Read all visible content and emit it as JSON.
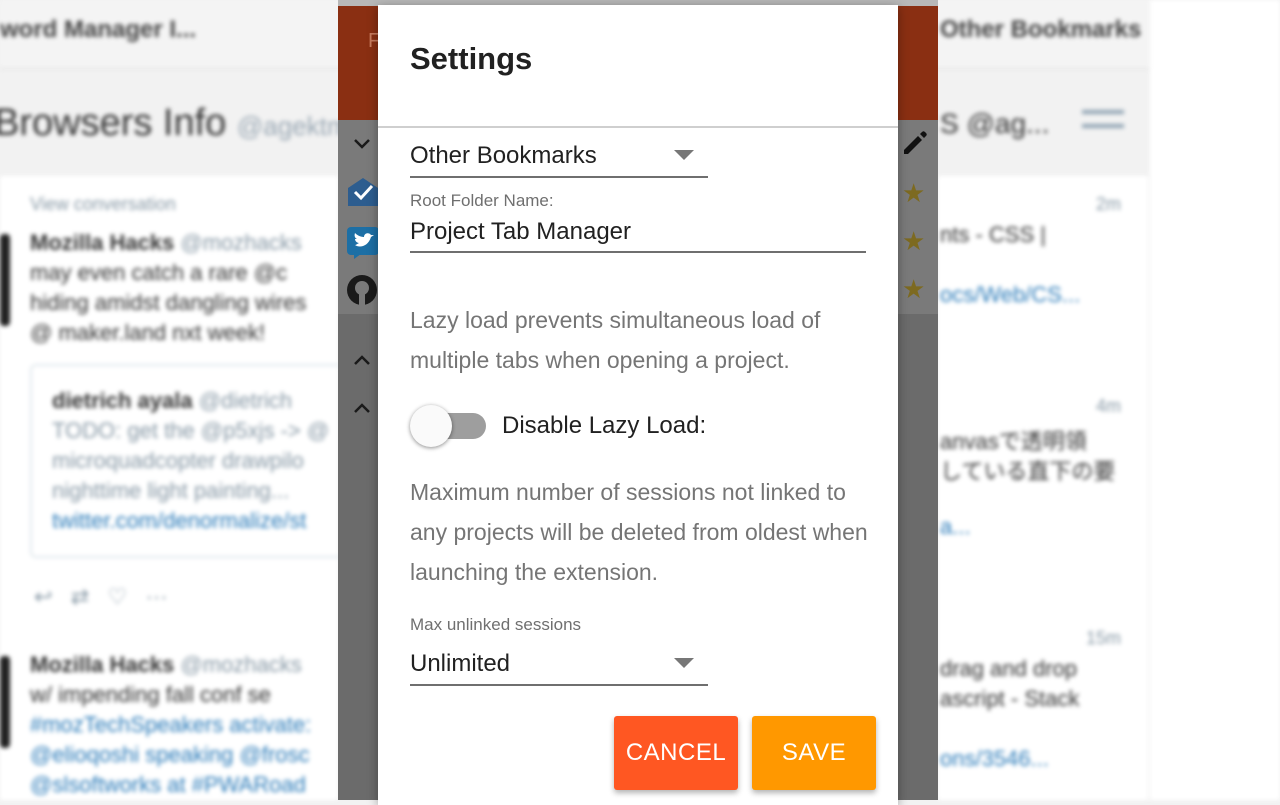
{
  "background": {
    "tabs": [
      "word Manager I...",
      "Other Bookmarks"
    ],
    "column_title": "Browsers Info",
    "column_handle": "@agektm",
    "right_column_title": "S @ag...",
    "tweets": [
      {
        "context": "View conversation",
        "author": "Mozilla Hacks",
        "handle": "@mozhacks",
        "lines": [
          "may even catch a rare @c",
          "hiding amidst dangling wires",
          "@ maker.land nxt week!"
        ],
        "quote": {
          "author": "dietrich ayala",
          "handle": "@dietrich",
          "lines": [
            "TODO: get the @p5xjs -> @",
            "microquadcopter drawpilo",
            "nighttime light painting...",
            "twitter.com/denormalize/st"
          ]
        }
      },
      {
        "author": "Mozilla Hacks",
        "handle": "@mozhacks",
        "lines": [
          "w/ impending fall conf se",
          "#mozTechSpeakers activate:",
          "@elioqoshi speaking @frosc",
          "@slsoftworks at #PWARoad"
        ]
      }
    ],
    "right_items": [
      {
        "time": "2m",
        "lines": [
          "nts - CSS |",
          "ocs/Web/CS..."
        ]
      },
      {
        "time": "4m",
        "lines": [
          "anvasで透明領",
          "している直下の要",
          "a..."
        ]
      },
      {
        "time": "15m",
        "lines": [
          "drag and drop",
          "ascript - Stack",
          "ons/3546..."
        ]
      }
    ]
  },
  "popup": {
    "header_ghost": "F",
    "icons": [
      "chevron-down-icon",
      "inbox-icon",
      "twitter-icon",
      "github-icon"
    ],
    "stars": 3
  },
  "settings": {
    "title": "Settings",
    "bookmark_folder": "Other Bookmarks",
    "root_folder_label": "Root Folder Name:",
    "root_folder_value": "Project Tab Manager",
    "lazy_load_description": "Lazy load prevents simultaneous load of multiple tabs when opening a project.",
    "lazy_load_toggle_label": "Disable Lazy Load:",
    "lazy_load_disabled": false,
    "max_sessions_description": "Maximum number of sessions not linked to any projects will be deleted from oldest when launching the extension.",
    "max_sessions_label": "Max unlinked sessions",
    "max_sessions_value": "Unlimited",
    "cancel_label": "CANCEL",
    "save_label": "SAVE",
    "colors": {
      "cancel": "#ff5722",
      "save": "#ff9800"
    }
  }
}
